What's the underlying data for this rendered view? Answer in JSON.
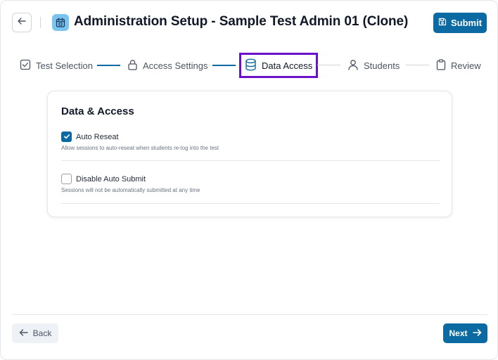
{
  "header": {
    "title": "Administration Setup - Sample Test Admin 01 (Clone)",
    "submit_label": "Submit"
  },
  "stepper": {
    "steps": [
      {
        "label": "Test Selection",
        "icon": "checkbox-icon",
        "state": "completed"
      },
      {
        "label": "Access Settings",
        "icon": "lock-icon",
        "state": "completed"
      },
      {
        "label": "Data Access",
        "icon": "database-icon",
        "state": "active"
      },
      {
        "label": "Students",
        "icon": "user-icon",
        "state": "pending"
      },
      {
        "label": "Review",
        "icon": "clipboard-icon",
        "state": "pending"
      }
    ]
  },
  "card": {
    "title": "Data & Access",
    "options": [
      {
        "label": "Auto Reseat",
        "description": "Allow sessions to auto-reseat when students re-log into the test",
        "checked": true
      },
      {
        "label": "Disable Auto Submit",
        "description": "Sessions will not be automatically submitted at any time",
        "checked": false
      }
    ]
  },
  "footer": {
    "back_label": "Back",
    "next_label": "Next"
  },
  "colors": {
    "primary": "#0c6aa3",
    "active_step_outline": "#6a11c9",
    "app_icon_bg": "#7cc4f0"
  }
}
